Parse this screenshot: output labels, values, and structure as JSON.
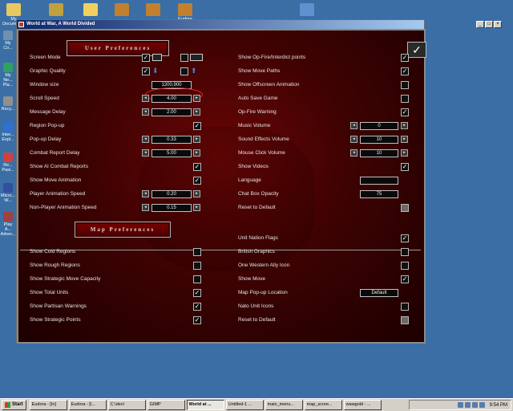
{
  "desktop": {
    "icons_top": [
      {
        "label": "My Documents",
        "color": "#e8c860"
      },
      {
        "label": "",
        "color": "#c0a040"
      },
      {
        "label": "",
        "color": "#f0d060"
      },
      {
        "label": "",
        "color": "#c08030"
      },
      {
        "label": "",
        "color": "#c08030"
      },
      {
        "label": "Eudora",
        "color": "#c08030"
      },
      {
        "label": "",
        "color": "#6090d0"
      }
    ],
    "icons_left": [
      {
        "label": "My Co...",
        "color": "#7090b0"
      },
      {
        "label": "My Ne... Pla...",
        "color": "#30a060"
      },
      {
        "label": "Recy...",
        "color": "#909090"
      },
      {
        "label": "Inter... Expl...",
        "color": "#3070d0"
      },
      {
        "label": "Re... Pasi...",
        "color": "#d04040"
      },
      {
        "label": "Micro... W...",
        "color": "#3050a0"
      },
      {
        "label": "Play A... Adver...",
        "color": "#a04040"
      }
    ]
  },
  "window": {
    "title": "World at War, A World Divided",
    "buttons": {
      "minimize": "_",
      "maximize": "□",
      "close": "×"
    }
  },
  "sections": {
    "user_prefs": "User Preferences",
    "map_prefs": "Map Preferences"
  },
  "ok_button": {
    "glyph": "✓"
  },
  "user_left": {
    "screen_mode": "Screen Mode",
    "graphic_quality": "Graphic Quality",
    "window_size": "Window size",
    "window_size_value": "1200,900",
    "scroll_speed": "Scroll Speed",
    "scroll_speed_value": "4.00",
    "message_delay": "Message Delay",
    "message_delay_value": "2.00",
    "region_popup": "Region Pop-up",
    "popup_delay": "Pop-up Delay",
    "popup_delay_value": "0.33",
    "combat_report_delay": "Combat Report Delay",
    "combat_report_delay_value": "5.00",
    "show_ai_combat_reports": "Show AI Combat Reports",
    "show_move_animation": "Show Move Animation",
    "player_anim_speed": "Player Animation Speed",
    "player_anim_speed_value": "0.20",
    "nonplayer_anim_speed": "Non-Player Animation Speed",
    "nonplayer_anim_speed_value": "0.15"
  },
  "user_right": {
    "show_opfire": "Show Op-Fire/Interdict points",
    "show_move_paths": "Show Move Paths",
    "show_offscreen_anim": "Show Offscreen Animation",
    "auto_save": "Auto Save Game",
    "opfire_warning": "Op-Fire Warning",
    "music_volume": "Music Volume",
    "music_volume_value": "0",
    "sfx_volume": "Sound Effects Volume",
    "sfx_volume_value": "10",
    "mouse_click_volume": "Mouse Click Volume",
    "mouse_click_volume_value": "10",
    "show_videos": "Show Videos",
    "language": "Language",
    "language_value": "",
    "chat_box_opacity": "Chat Box Opacity",
    "chat_box_opacity_value": "75",
    "reset_default": "Reset to Default"
  },
  "map_left": {
    "show_cold_regions": "Show Cold Regions",
    "show_rough_regions": "Show Rough Regions",
    "show_strategic_move_capacity": "Show Strategic Move Capacity",
    "show_total_units": "Show Total Units",
    "show_partisan_warnings": "Show Partisan Warnings",
    "show_strategic_points": "Show Strategic Points"
  },
  "map_right": {
    "unit_nation_flags": "Unit Nation Flags",
    "british_graphics": "British Graphics",
    "one_western_ally_icon": "One Western Ally Icon",
    "show_move": "Show Move",
    "map_popup_location": "Map Pop-up Location",
    "map_popup_location_value": "Default",
    "nato_unit_icons": "Nato Unit Icons",
    "reset_default": "Reset to Default"
  },
  "taskbar": {
    "start": "Start",
    "items": [
      {
        "label": "Eudora - [In]",
        "active": false
      },
      {
        "label": "Eudora - [I...",
        "active": false
      },
      {
        "label": "C:\\dev\\",
        "active": false
      },
      {
        "label": "GIMP",
        "active": false
      },
      {
        "label": "World at ...",
        "active": true
      },
      {
        "label": "Untitled-1 ...",
        "active": false
      },
      {
        "label": "main_menu...",
        "active": false
      },
      {
        "label": "map_scree...",
        "active": false
      },
      {
        "label": "wawgold - ...",
        "active": false
      }
    ],
    "clock": "9:54 PM"
  }
}
